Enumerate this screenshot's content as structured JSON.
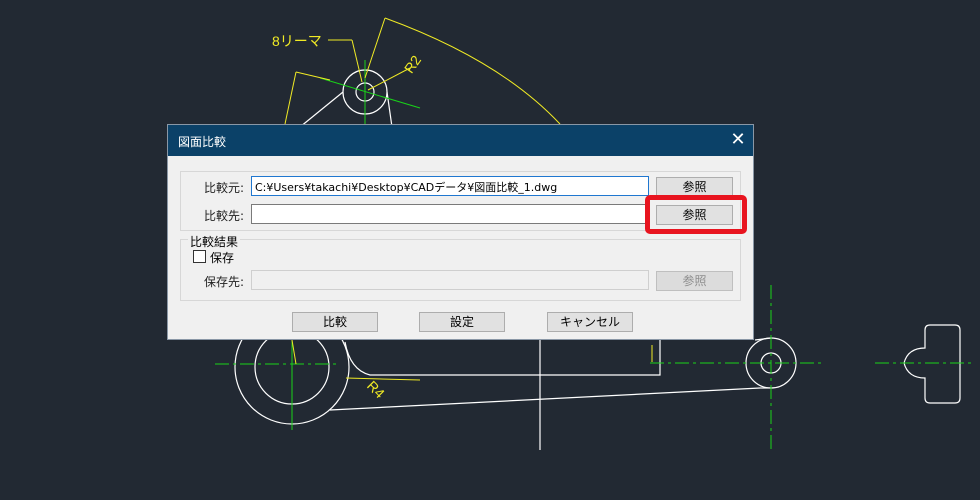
{
  "cad": {
    "annotation_reamer": "8リーマ",
    "annotation_r2": "R2",
    "annotation_r4": "R4"
  },
  "dialog": {
    "title": "図面比較",
    "close_glyph": "✕",
    "source_label": "比較元:",
    "source_value": "C:¥Users¥takachi¥Desktop¥CADデータ¥図面比較_1.dwg",
    "target_label": "比較先:",
    "target_value": "",
    "browse_label": "参照",
    "result_group_label": "比較結果",
    "save_checkbox_label": "保存",
    "save_checked": false,
    "save_to_label": "保存先:",
    "save_to_value": "",
    "compare_button": "比較",
    "settings_button": "設定",
    "cancel_button": "キャンセル"
  },
  "colors": {
    "canvas_bg": "#222933",
    "dialog_title_bg": "#0b4168",
    "highlight": "#e8141f",
    "annotation": "#f0ea25",
    "centerline": "#19d219"
  }
}
